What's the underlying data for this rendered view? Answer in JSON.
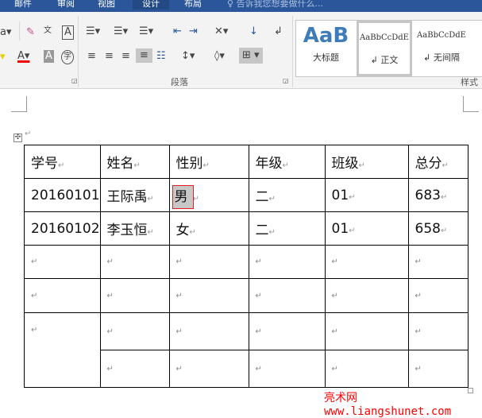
{
  "tabs": [
    "邮件",
    "审阅",
    "视图",
    "设计",
    "布局"
  ],
  "active_tab": "设计",
  "tell_me": "告诉我您想要做什么...",
  "ribbon": {
    "paragraph_group": "段落",
    "styles_group": "样式",
    "styles": [
      {
        "preview": "AaB",
        "label": "大标题"
      },
      {
        "preview": "AaBbCcDdE",
        "label": "↲ 正文"
      },
      {
        "preview": "AaBbCcDdE",
        "label": "↲ 无间隔"
      }
    ]
  },
  "table": {
    "header": [
      "学号",
      "姓名",
      "性别",
      "年级",
      "班级",
      "总分"
    ],
    "rows": [
      [
        "20160101",
        "王际禹",
        "男",
        "二",
        "01",
        "683"
      ],
      [
        "20160102",
        "李玉恒",
        "女",
        "二",
        "01",
        "658"
      ]
    ],
    "selected_cell": "男"
  },
  "paragraph_mark": "↵",
  "watermark": "亮术网 www.liangshunet.com"
}
